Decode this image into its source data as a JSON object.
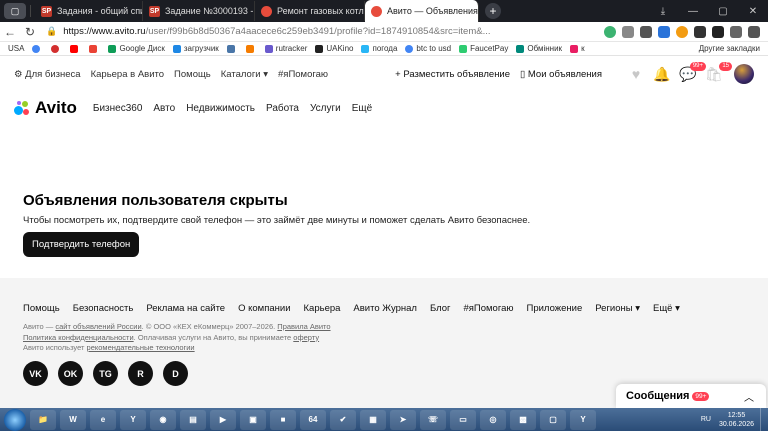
{
  "browser": {
    "tabs": [
      {
        "label": "Задания - общий список",
        "favicon": "SP",
        "color": "#c0392b"
      },
      {
        "label": "Задание №3000193 - про",
        "favicon": "SP",
        "color": "#c0392b"
      },
      {
        "label": "Ремонт газовых котлов и",
        "favicon": "",
        "color": "#e74c3c"
      },
      {
        "label": "Авито — Объявления и",
        "favicon": "",
        "color": "#e74c3c",
        "active": true
      }
    ],
    "url_host": "https://www.avito.ru",
    "url_path": "/user/f99b6b8d50367a4aacece6c259eb3491/profile?id=1874910854&src=item&...",
    "bookmarks": [
      "USA",
      "Google Диск",
      "загрузчик",
      "rutracker",
      "UAKino",
      "погода",
      "btc to usd",
      "FaucetPay",
      "Обмінник",
      "к"
    ],
    "bookmarks_more": "Другие закладки"
  },
  "topnav": {
    "left": [
      "Для бизнеса",
      "Карьера в Авито",
      "Помощь",
      "Каталоги",
      "#яПомогаю"
    ],
    "post_ad": "Разместить объявление",
    "my_ads": "Мои объявления",
    "messages_badge": "99+",
    "notifications_badge": "15"
  },
  "mainnav": {
    "logo": "Avito",
    "items": [
      "Бизнес360",
      "Авто",
      "Недвижимость",
      "Работа",
      "Услуги",
      "Ещё"
    ]
  },
  "notice": {
    "title": "Объявления пользователя скрыты",
    "text": "Чтобы посмотреть их, подтвердите свой телефон — это займёт две минуты и поможет сделать Авито безопаснее.",
    "button": "Подтвердить телефон"
  },
  "footer": {
    "links": [
      "Помощь",
      "Безопасность",
      "Реклама на сайте",
      "О компании",
      "Карьера",
      "Авито Журнал",
      "Блог",
      "#яПомогаю",
      "Приложение",
      "Регионы",
      "Ещё"
    ],
    "legal_1a": "Авито — ",
    "legal_1b": "сайт объявлений России",
    "legal_1c": ". © ООО «КЕХ еКоммерц» 2007–2026. ",
    "legal_1d": "Правила Авито",
    "legal_2a": "Политика конфиденциальности",
    "legal_2b": ". Оплачивая услуги на Авито, вы принимаете ",
    "legal_2c": "оферту",
    "legal_3a": "Авито использует ",
    "legal_3b": "рекомендательные технологии",
    "social": [
      "VK",
      "OK",
      "TG",
      "R",
      "D"
    ]
  },
  "messages_widget": {
    "label": "Сообщения",
    "badge": "99+"
  },
  "taskbar": {
    "lang": "RU",
    "time": "12:55",
    "date": "30.06.2026"
  },
  "colors": {
    "avito_blue": "#00aaff",
    "avito_green": "#97cf26",
    "avito_red": "#ff4053",
    "avito_purple": "#a169f7"
  }
}
